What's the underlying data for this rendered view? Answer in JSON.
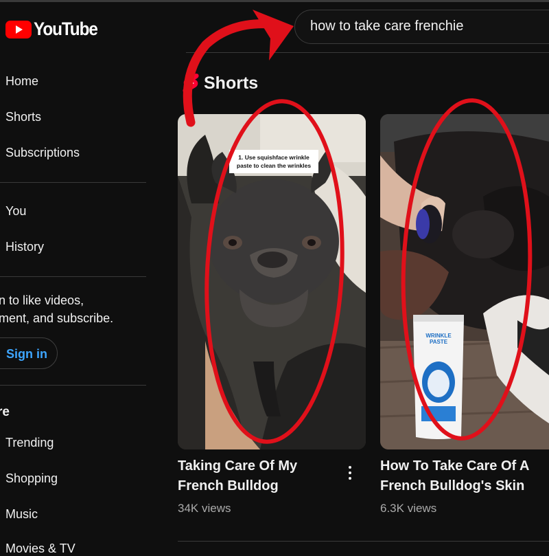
{
  "app": {
    "logo_text": "YouTube"
  },
  "search": {
    "query": "how to take care frenchie"
  },
  "sidebar": {
    "items": [
      {
        "label": "Home"
      },
      {
        "label": "Shorts"
      },
      {
        "label": "Subscriptions"
      },
      {
        "label": "You"
      },
      {
        "label": "History"
      }
    ],
    "signin_prompt_line1": "n to like videos,",
    "signin_prompt_line2": "ment, and subscribe.",
    "signin_button": "Sign in",
    "explore_title": "re",
    "explore_items": [
      {
        "label": "Trending"
      },
      {
        "label": "Shopping"
      },
      {
        "label": "Music"
      },
      {
        "label": "Movies & TV"
      }
    ]
  },
  "shorts_section": {
    "title": "Shorts",
    "videos": [
      {
        "title_line1": "Taking Care Of My",
        "title_line2": "French Bulldog",
        "views": "34K views",
        "overlay_caption_line1": "1. Use squishface wrinkle",
        "overlay_caption_line2": "paste to clean the wrinkles"
      },
      {
        "title_line1": "How To Take Care Of A",
        "title_line2": "French Bulldog's Skin",
        "views": "6.3K views",
        "product_label": "WRINKLE PASTE"
      }
    ]
  },
  "colors": {
    "background": "#0f0f0f",
    "brand_red": "#ff0000",
    "annotation_red": "#e0101a",
    "link_blue": "#3ea6ff"
  }
}
